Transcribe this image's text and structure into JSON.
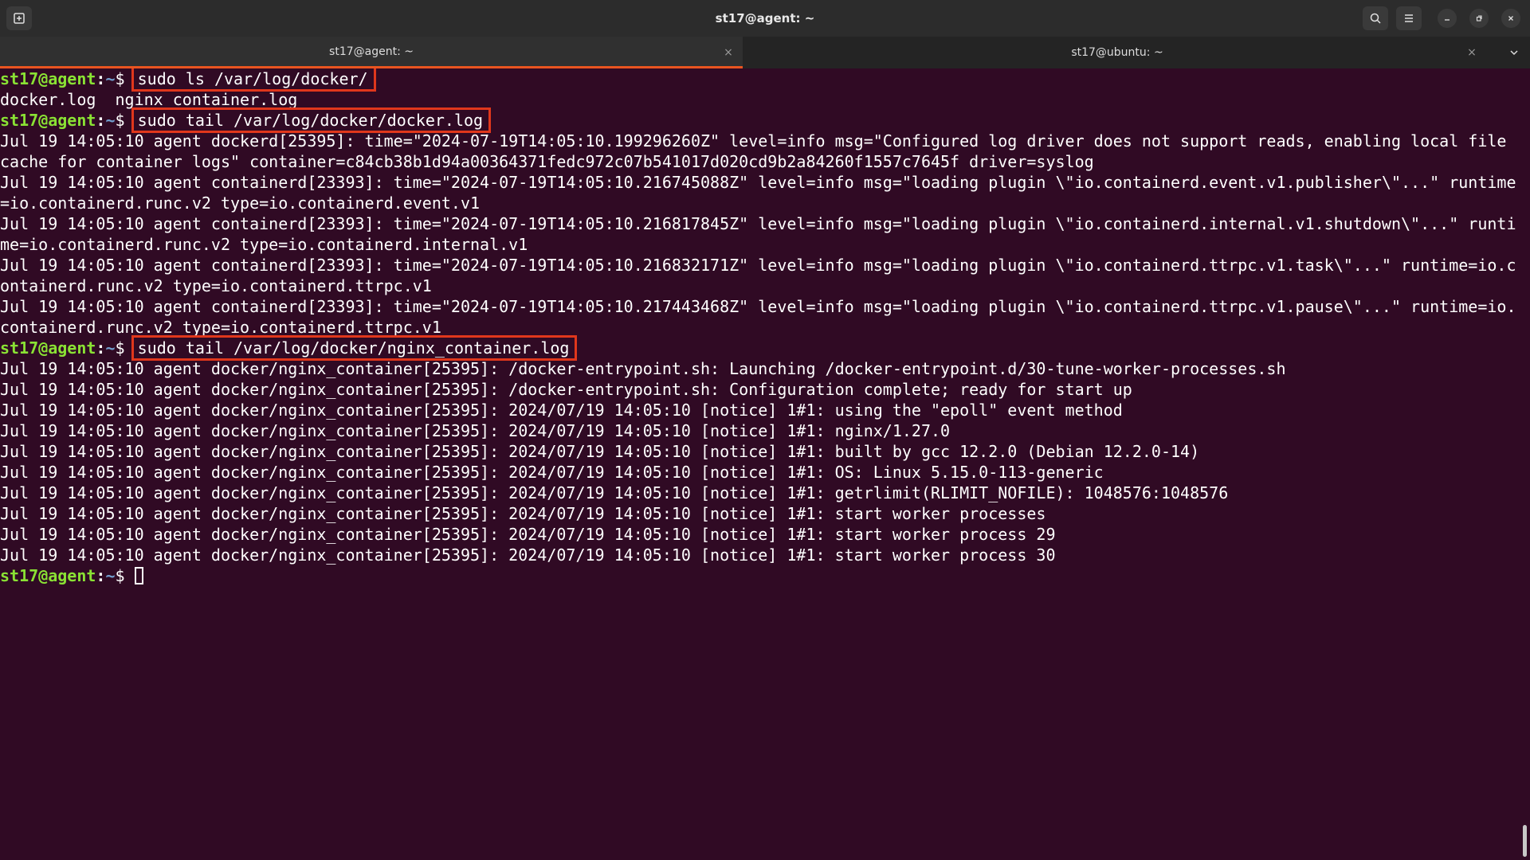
{
  "window": {
    "title": "st17@agent: ~",
    "buttons": {
      "new_tab_icon": "new-tab-icon",
      "search_icon": "search-icon",
      "menu_icon": "hamburger-menu-icon",
      "minimize_icon": "minimize-icon",
      "maximize_icon": "maximize-icon",
      "close_icon": "close-icon"
    }
  },
  "tabs": [
    {
      "label": "st17@agent: ~",
      "active": true,
      "close": "×"
    },
    {
      "label": "st17@ubuntu: ~",
      "active": false,
      "close": "×"
    }
  ],
  "colors": {
    "background": "#300a24",
    "prompt_user": "#8ae234",
    "prompt_path": "#729fcf",
    "highlight_box": "#e0371c",
    "active_tab_accent": "#e95420"
  },
  "prompt": {
    "user_host": "st17@agent",
    "colon": ":",
    "path": "~",
    "dollar": "$ "
  },
  "commands": [
    "sudo ls /var/log/docker/",
    "sudo tail /var/log/docker/docker.log",
    "sudo tail /var/log/docker/nginx_container.log"
  ],
  "output_ls": [
    "docker.log  nginx_container.log"
  ],
  "output_docker": [
    "Jul 19 14:05:10 agent dockerd[25395]: time=\"2024-07-19T14:05:10.199296260Z\" level=info msg=\"Configured log driver does not support reads, enabling local file",
    "cache for container logs\" container=c84cb38b1d94a00364371fedc972c07b541017d020cd9b2a84260f1557c7645f driver=syslog",
    "Jul 19 14:05:10 agent containerd[23393]: time=\"2024-07-19T14:05:10.216745088Z\" level=info msg=\"loading plugin \\\"io.containerd.event.v1.publisher\\\"...\" runtime",
    "=io.containerd.runc.v2 type=io.containerd.event.v1",
    "Jul 19 14:05:10 agent containerd[23393]: time=\"2024-07-19T14:05:10.216817845Z\" level=info msg=\"loading plugin \\\"io.containerd.internal.v1.shutdown\\\"...\" runti",
    "me=io.containerd.runc.v2 type=io.containerd.internal.v1",
    "Jul 19 14:05:10 agent containerd[23393]: time=\"2024-07-19T14:05:10.216832171Z\" level=info msg=\"loading plugin \\\"io.containerd.ttrpc.v1.task\\\"...\" runtime=io.c",
    "ontainerd.runc.v2 type=io.containerd.ttrpc.v1",
    "Jul 19 14:05:10 agent containerd[23393]: time=\"2024-07-19T14:05:10.217443468Z\" level=info msg=\"loading plugin \\\"io.containerd.ttrpc.v1.pause\\\"...\" runtime=io.",
    "containerd.runc.v2 type=io.containerd.ttrpc.v1"
  ],
  "output_nginx": [
    "Jul 19 14:05:10 agent docker/nginx_container[25395]: /docker-entrypoint.sh: Launching /docker-entrypoint.d/30-tune-worker-processes.sh",
    "Jul 19 14:05:10 agent docker/nginx_container[25395]: /docker-entrypoint.sh: Configuration complete; ready for start up",
    "Jul 19 14:05:10 agent docker/nginx_container[25395]: 2024/07/19 14:05:10 [notice] 1#1: using the \"epoll\" event method",
    "Jul 19 14:05:10 agent docker/nginx_container[25395]: 2024/07/19 14:05:10 [notice] 1#1: nginx/1.27.0",
    "Jul 19 14:05:10 agent docker/nginx_container[25395]: 2024/07/19 14:05:10 [notice] 1#1: built by gcc 12.2.0 (Debian 12.2.0-14)",
    "Jul 19 14:05:10 agent docker/nginx_container[25395]: 2024/07/19 14:05:10 [notice] 1#1: OS: Linux 5.15.0-113-generic",
    "Jul 19 14:05:10 agent docker/nginx_container[25395]: 2024/07/19 14:05:10 [notice] 1#1: getrlimit(RLIMIT_NOFILE): 1048576:1048576",
    "Jul 19 14:05:10 agent docker/nginx_container[25395]: 2024/07/19 14:05:10 [notice] 1#1: start worker processes",
    "Jul 19 14:05:10 agent docker/nginx_container[25395]: 2024/07/19 14:05:10 [notice] 1#1: start worker process 29",
    "Jul 19 14:05:10 agent docker/nginx_container[25395]: 2024/07/19 14:05:10 [notice] 1#1: start worker process 30"
  ]
}
